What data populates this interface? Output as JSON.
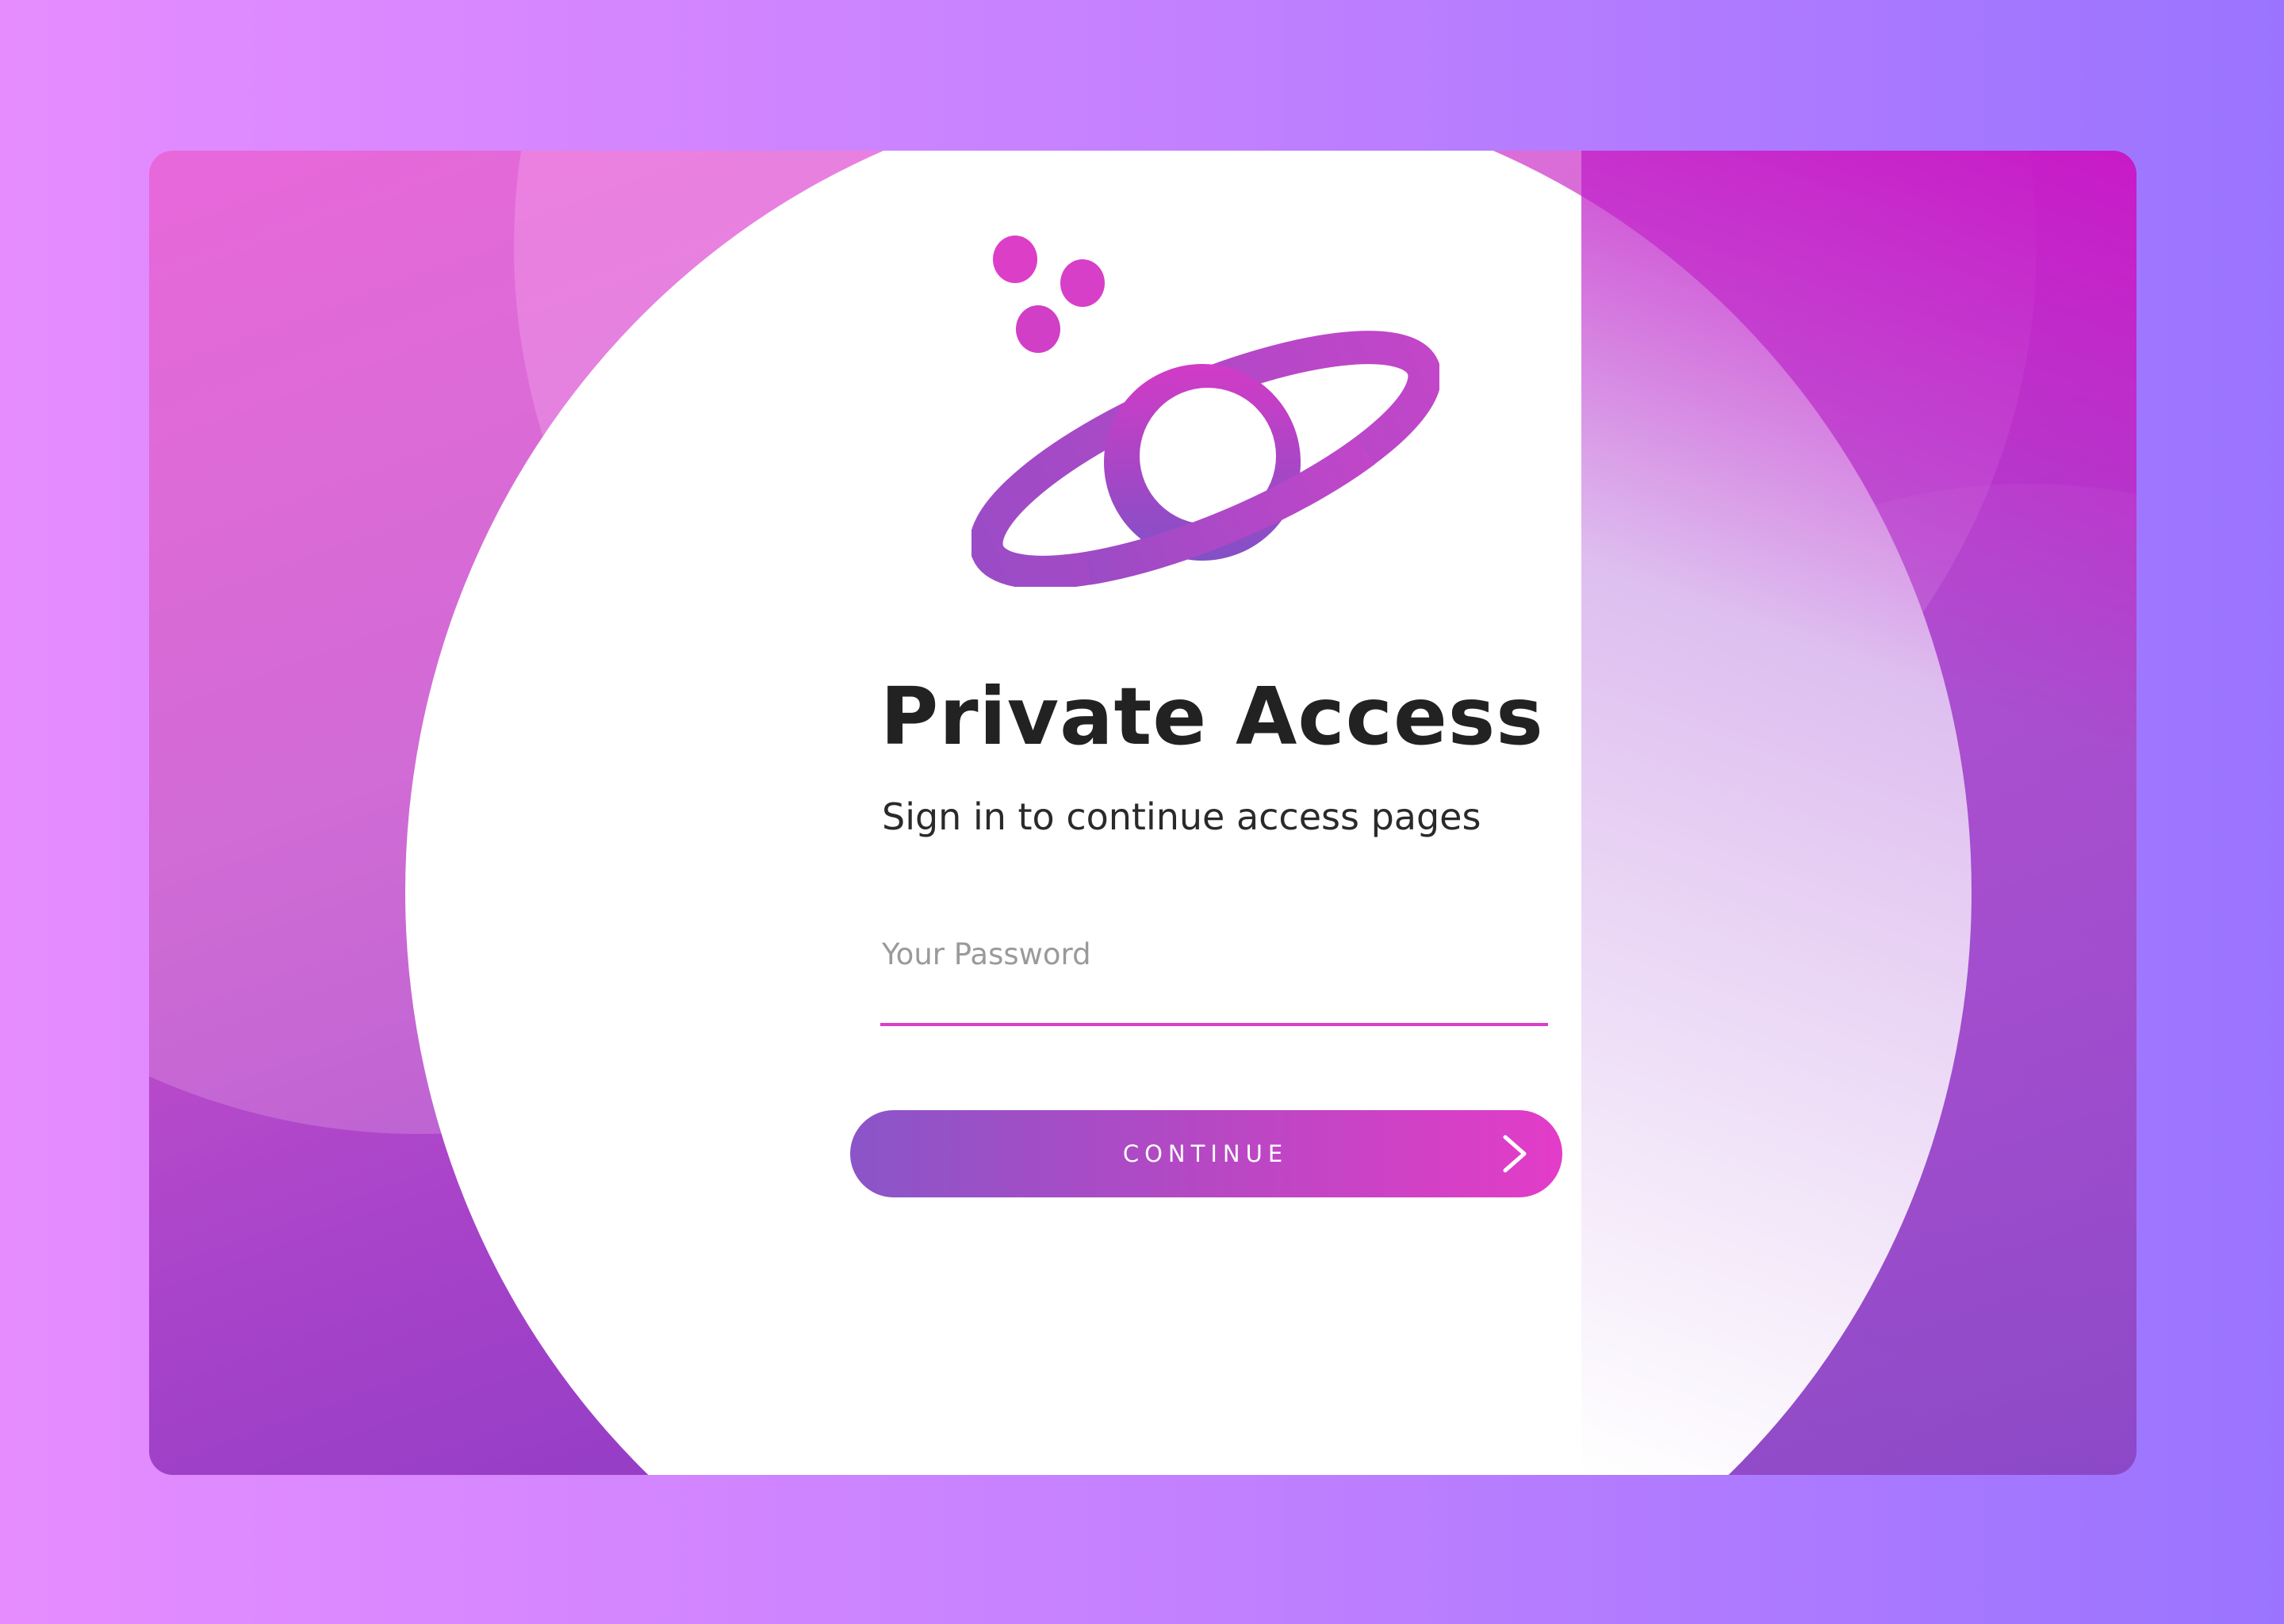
{
  "login": {
    "title": "Private Access",
    "subtitle": "Sign in to continue access pages",
    "password": {
      "placeholder": "Your Password",
      "value": ""
    },
    "continue_label": "CONTINUE"
  },
  "icons": {
    "logo": "planet-icon",
    "continue": "chevron-right-icon"
  },
  "colors": {
    "accent_pink": "#e23cc8",
    "accent_purple": "#8a55c8",
    "title_text": "#222222",
    "placeholder_text": "#9a9a9a"
  }
}
